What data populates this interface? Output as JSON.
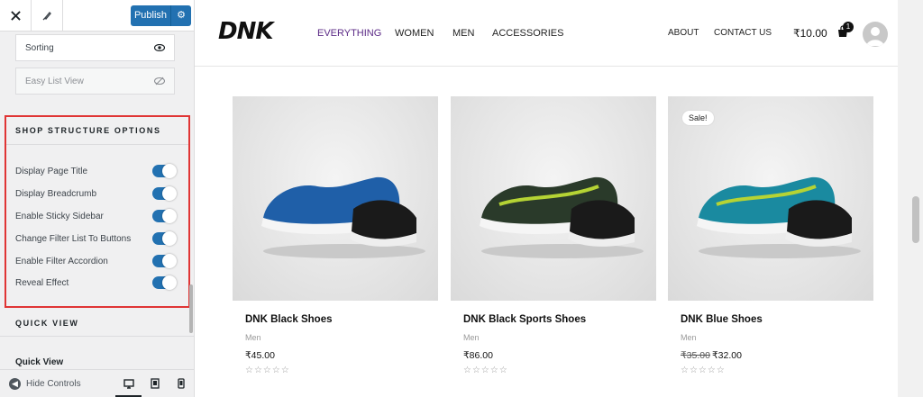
{
  "customizer": {
    "publish_label": "Publish",
    "options": [
      {
        "label": "Sorting",
        "icon": "eye-icon"
      },
      {
        "label": "Easy List View",
        "icon": "eye-slash-icon"
      }
    ],
    "shop_structure": {
      "title": "SHOP STRUCTURE OPTIONS",
      "toggles": [
        {
          "label": "Display Page Title",
          "on": true
        },
        {
          "label": "Display Breadcrumb",
          "on": true
        },
        {
          "label": "Enable Sticky Sidebar",
          "on": true
        },
        {
          "label": "Change Filter List To Buttons",
          "on": true
        },
        {
          "label": "Enable Filter Accordion",
          "on": true
        },
        {
          "label": "Reveal Effect",
          "on": true
        }
      ]
    },
    "quick_view": {
      "title": "QUICK VIEW",
      "label": "Quick View"
    },
    "footer": {
      "hide_controls": "Hide Controls"
    }
  },
  "site": {
    "logo": "DNK",
    "nav": [
      "EVERYTHING",
      "WOMEN",
      "MEN",
      "ACCESSORIES"
    ],
    "nav_active": "EVERYTHING",
    "links": [
      "ABOUT",
      "CONTACT US"
    ],
    "cart_total": "₹10.00",
    "cart_count": "1",
    "accent_color": "#5b2a86",
    "products": [
      {
        "name": "DNK Black Shoes",
        "category": "Men",
        "price": "₹45.00",
        "old_price": "",
        "sale": "",
        "shoe_color": "#1f5fa8"
      },
      {
        "name": "DNK Black Sports Shoes",
        "category": "Men",
        "price": "₹86.00",
        "old_price": "",
        "sale": "",
        "shoe_color": "#2a3a2a"
      },
      {
        "name": "DNK Blue Shoes",
        "category": "Men",
        "price": "₹32.00",
        "old_price": "₹35.00",
        "sale": "Sale!",
        "shoe_color": "#1a8aa0"
      }
    ],
    "rating_stars": "☆☆☆☆☆"
  }
}
